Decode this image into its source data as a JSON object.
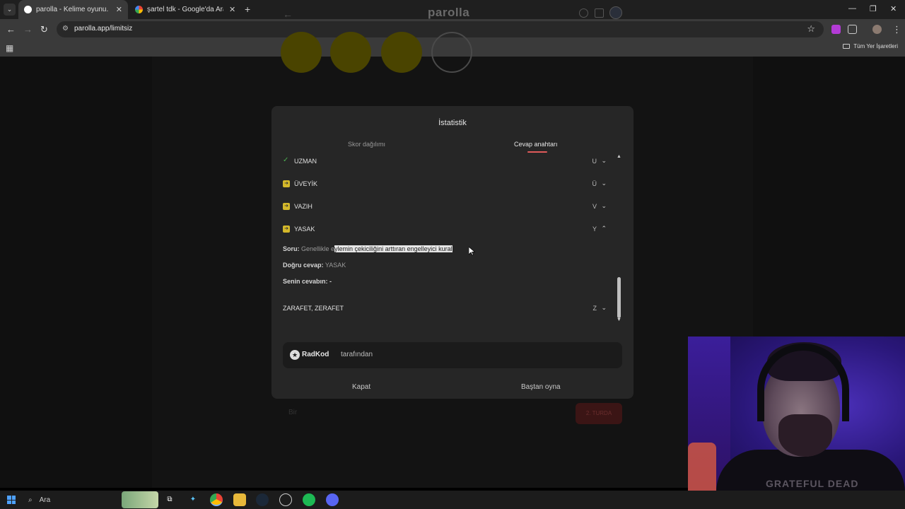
{
  "browser": {
    "tabs": [
      {
        "title": "parolla - Kelime oyunu. Günlük",
        "active": true
      },
      {
        "title": "şartel tdk - Google'da Ara",
        "active": false
      }
    ],
    "url": "parolla.app/limitsiz",
    "bookmarks_all": "Tüm Yer İşaretleri"
  },
  "site": {
    "logo": "parolla",
    "bottom_input_placeholder": "Bir",
    "bottom_button": "2. TURDA"
  },
  "modal": {
    "title": "İstatistik",
    "tabs": {
      "score": "Skor dağılımı",
      "answers": "Cevap anahtarı"
    },
    "rows": [
      {
        "word": "UZMAN",
        "letter": "U",
        "status": "correct"
      },
      {
        "word": "ÜVEYİK",
        "letter": "Ü",
        "status": "passed"
      },
      {
        "word": "VAZIH",
        "letter": "V",
        "status": "passed"
      },
      {
        "word": "YASAK",
        "letter": "Y",
        "status": "passed",
        "expanded": true
      }
    ],
    "detail": {
      "question_label": "Soru:",
      "question_pre": "Genellikle e",
      "question_highlight": "ylemin çekiciliğini arttıran engelleyici kural",
      "answer_label": "Doğru cevap:",
      "answer_value": "YASAK",
      "your_label": "Senin cevabın:",
      "your_value": "-"
    },
    "last_row": {
      "word": "ZARAFET, ZERAFET",
      "letter": "Z"
    },
    "credit": {
      "brand": "RadKod",
      "by": "tarafından"
    },
    "buttons": {
      "close": "Kapat",
      "restart": "Baştan oyna"
    }
  },
  "webcam": {
    "shirt_text": "GRATEFUL DEAD"
  },
  "taskbar": {
    "search": "Ara"
  }
}
